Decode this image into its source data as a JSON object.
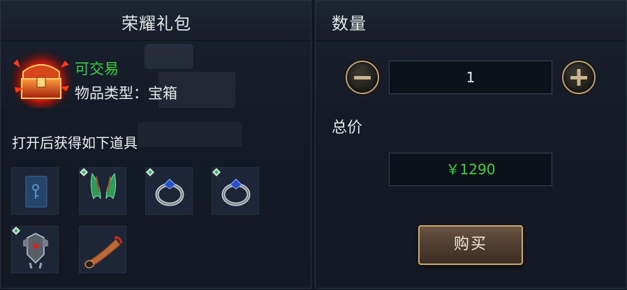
{
  "left_panel": {
    "title": "荣耀礼包",
    "item": {
      "icon": "treasure-chest-icon",
      "tradable": "可交易",
      "type_label": "物品类型：宝箱"
    },
    "contents_label": "打开后获得如下道具",
    "rewards": [
      {
        "icon": "blue-book-icon",
        "badge": false
      },
      {
        "icon": "green-wings-icon",
        "badge": true
      },
      {
        "icon": "sapphire-ring-icon",
        "badge": true
      },
      {
        "icon": "sapphire-ring-icon",
        "badge": true
      },
      {
        "icon": "armor-icon",
        "badge": true
      },
      {
        "icon": "horn-icon",
        "badge": false
      }
    ]
  },
  "right_panel": {
    "title": "数量",
    "quantity": "1",
    "total_label": "总价",
    "total_price": "￥1290",
    "buy_label": "购买"
  },
  "colors": {
    "tradable": "#35d43f",
    "price": "#3fd43a",
    "button_border": "#c2a982"
  }
}
